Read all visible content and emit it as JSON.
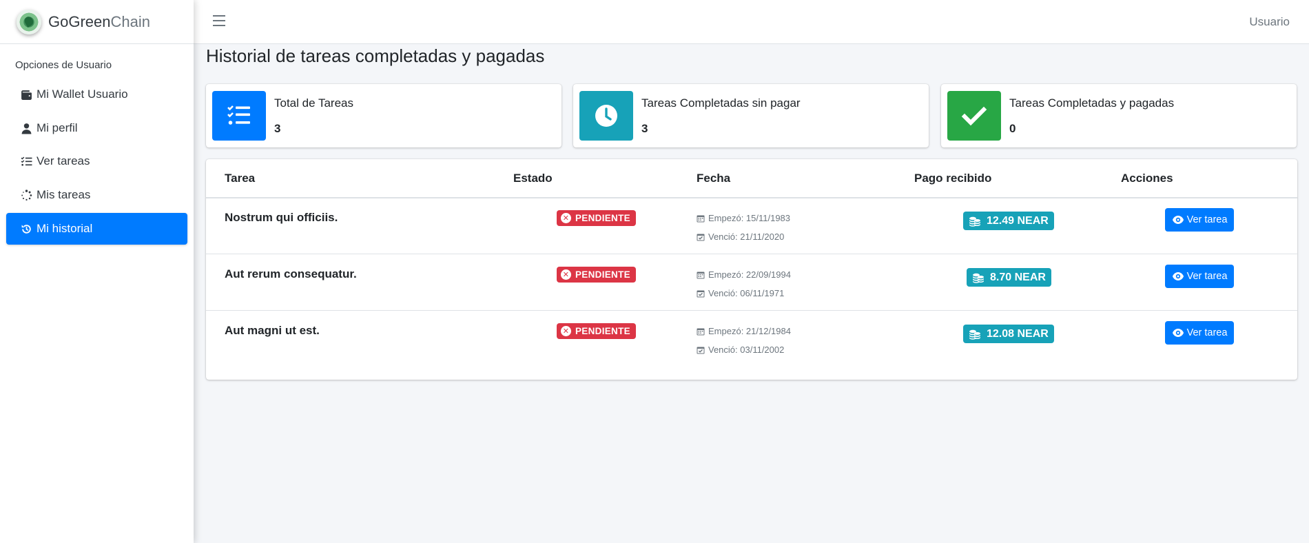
{
  "brand": {
    "name_bold": "GoGreen",
    "name_light": "Chain"
  },
  "sidebar": {
    "header": "Opciones de Usuario",
    "items": [
      {
        "label": "Mi Wallet Usuario",
        "icon": "wallet-icon"
      },
      {
        "label": "Mi perfil",
        "icon": "user-icon"
      },
      {
        "label": "Ver tareas",
        "icon": "list-check-icon"
      },
      {
        "label": "Mis tareas",
        "icon": "spinner-icon"
      },
      {
        "label": "Mi historial",
        "icon": "history-icon",
        "active": true
      }
    ]
  },
  "topbar": {
    "user": "Usuario"
  },
  "page": {
    "title": "Historial de tareas completadas y pagadas"
  },
  "info_boxes": [
    {
      "label": "Total de Tareas",
      "value": "3",
      "icon": "tasks-icon",
      "color": "#007bff"
    },
    {
      "label": "Tareas Completadas sin pagar",
      "value": "3",
      "icon": "clock-icon",
      "color": "#17a2b8"
    },
    {
      "label": "Tareas Completadas y pagadas",
      "value": "0",
      "icon": "check-icon",
      "color": "#28a745"
    }
  ],
  "table": {
    "headers": [
      "Tarea",
      "Estado",
      "Fecha",
      "Pago recibido",
      "Acciones"
    ],
    "rows": [
      {
        "task": "Nostrum qui officiis.",
        "status": "PENDIENTE",
        "start": "Empezó: 15/11/1983",
        "due": "Venció: 21/11/2020",
        "payment": "12.49 NEAR",
        "action": "Ver tarea"
      },
      {
        "task": "Aut rerum consequatur.",
        "status": "PENDIENTE",
        "start": "Empezó: 22/09/1994",
        "due": "Venció: 06/11/1971",
        "payment": "8.70 NEAR",
        "action": "Ver tarea"
      },
      {
        "task": "Aut magni ut est.",
        "status": "PENDIENTE",
        "start": "Empezó: 21/12/1984",
        "due": "Venció: 03/11/2002",
        "payment": "12.08 NEAR",
        "action": "Ver tarea"
      }
    ]
  },
  "colors": {
    "primary": "#007bff",
    "info": "#17a2b8",
    "success": "#28a745",
    "danger": "#dc3545"
  }
}
